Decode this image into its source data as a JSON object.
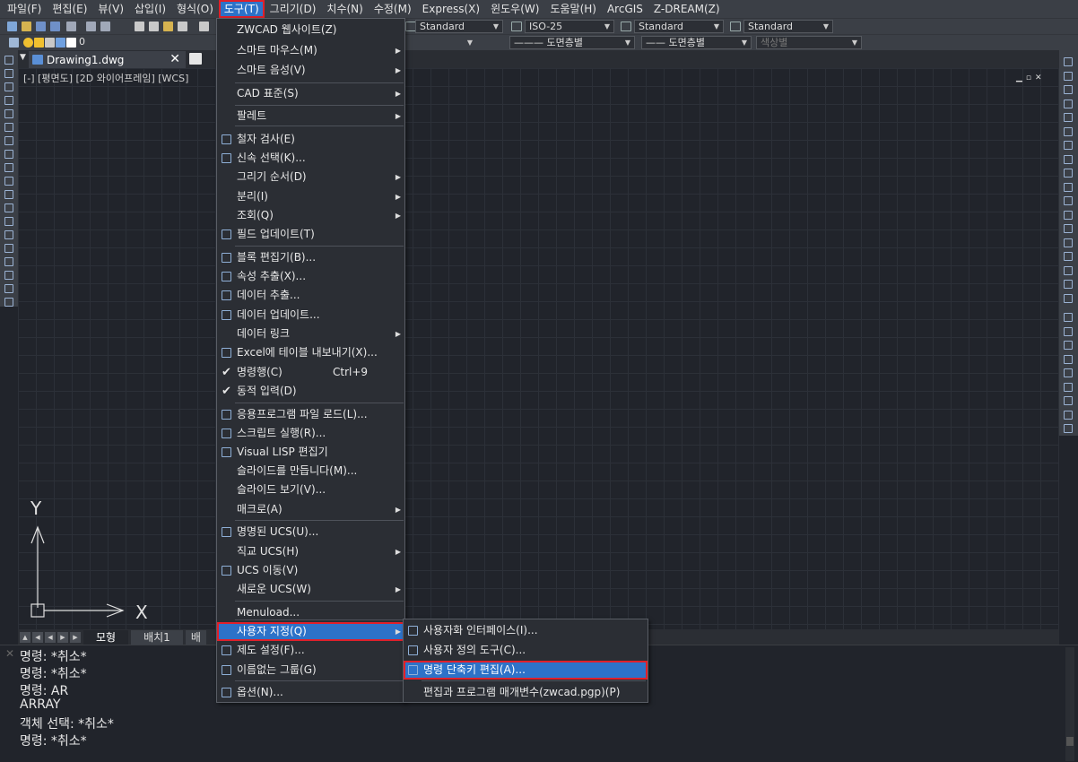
{
  "menubar": {
    "items": [
      "파일(F)",
      "편집(E)",
      "뷰(V)",
      "삽입(I)",
      "형식(O)",
      "도구(T)",
      "그리기(D)",
      "치수(N)",
      "수정(M)",
      "Express(X)",
      "윈도우(W)",
      "도움말(H)",
      "ArcGIS",
      "Z-DREAM(Z)"
    ],
    "active_index": 5
  },
  "toolbar1": {
    "text_style": "Standard",
    "dim_style": "ISO-25",
    "table_style": "Standard",
    "multileader_style": "Standard"
  },
  "toolbar2": {
    "layer": "0",
    "linetype": "도면층별",
    "lineweight": "도면층별",
    "color": "색상별"
  },
  "document": {
    "tab_title": "Drawing1.dwg",
    "viewport_label": "[-] [평면도] [2D 와이어프레임] [WCS]",
    "ucs_y": "Y",
    "ucs_x": "X"
  },
  "layout_tabs": [
    "모형",
    "배치1",
    "배"
  ],
  "command_lines": [
    "명령: *취소*",
    "명령: *취소*",
    "명령: AR",
    "ARRAY",
    "객체 선택: *취소*",
    "명령: *취소*"
  ],
  "tools_menu": {
    "items": [
      {
        "label": "ZWCAD 웹사이트(Z)"
      },
      {
        "label": "스마트 마우스(M)",
        "submenu": true
      },
      {
        "label": "스마트 음성(V)",
        "submenu": true
      },
      {
        "label": "CAD 표준(S)",
        "submenu": true
      },
      {
        "label": "팔레트",
        "submenu": true
      },
      {
        "label": "철자 검사(E)",
        "icon": "spell-check-icon"
      },
      {
        "label": "신속 선택(K)...",
        "icon": "quick-select-icon"
      },
      {
        "label": "그리기 순서(D)",
        "submenu": true
      },
      {
        "label": "분리(I)",
        "submenu": true
      },
      {
        "label": "조회(Q)",
        "submenu": true
      },
      {
        "label": "필드 업데이트(T)",
        "icon": "update-fields-icon"
      },
      {
        "label": "블록 편집기(B)...",
        "icon": "block-editor-icon"
      },
      {
        "label": "속성 추출(X)...",
        "icon": "attribute-extract-icon"
      },
      {
        "label": "데이터 추출...",
        "icon": "data-extract-icon"
      },
      {
        "label": "데이터 업데이트...",
        "icon": "data-update-icon"
      },
      {
        "label": "데이터 링크",
        "submenu": true
      },
      {
        "label": "Excel에 테이블 내보내기(X)...",
        "icon": "excel-export-icon"
      },
      {
        "label": "명령행(C)",
        "shortcut": "Ctrl+9",
        "checked": true
      },
      {
        "label": "동적 입력(D)",
        "checked": true
      },
      {
        "label": "응용프로그램 파일 로드(L)...",
        "icon": "load-application-icon"
      },
      {
        "label": "스크립트 실행(R)...",
        "icon": "run-script-icon"
      },
      {
        "label": "Visual LISP 편집기",
        "icon": "vlisp-icon"
      },
      {
        "label": "슬라이드를 만듭니다(M)..."
      },
      {
        "label": "슬라이드 보기(V)..."
      },
      {
        "label": "매크로(A)",
        "submenu": true
      },
      {
        "label": "명명된 UCS(U)...",
        "icon": "named-ucs-icon"
      },
      {
        "label": "직교 UCS(H)",
        "submenu": true
      },
      {
        "label": "UCS 이동(V)",
        "icon": "move-ucs-icon"
      },
      {
        "label": "새로운 UCS(W)",
        "submenu": true
      },
      {
        "label": "Menuload..."
      },
      {
        "label": "사용자 지정(Q)",
        "submenu": true,
        "highlighted": true
      },
      {
        "label": "제도 설정(F)...",
        "icon": "drafting-settings-icon"
      },
      {
        "label": "이름없는 그룹(G)",
        "icon": "group-icon"
      },
      {
        "label": "옵션(N)...",
        "icon": "options-icon"
      }
    ]
  },
  "customize_submenu": {
    "items": [
      {
        "label": "사용자화 인터페이스(I)...",
        "icon": "cui-icon"
      },
      {
        "label": "사용자 정의 도구(C)...",
        "icon": "custom-tool-icon"
      },
      {
        "label": "명령 단축키 편집(A)...",
        "icon": "edit-aliases-icon",
        "highlighted": true
      },
      {
        "label": "편집과 프로그램 매개변수(zwcad.pgp)(P)"
      }
    ]
  },
  "colors": {
    "accent": "#2d72c8",
    "highlight_border": "#e0202a",
    "background": "#21242b",
    "menu_bg": "#2b2e34"
  }
}
